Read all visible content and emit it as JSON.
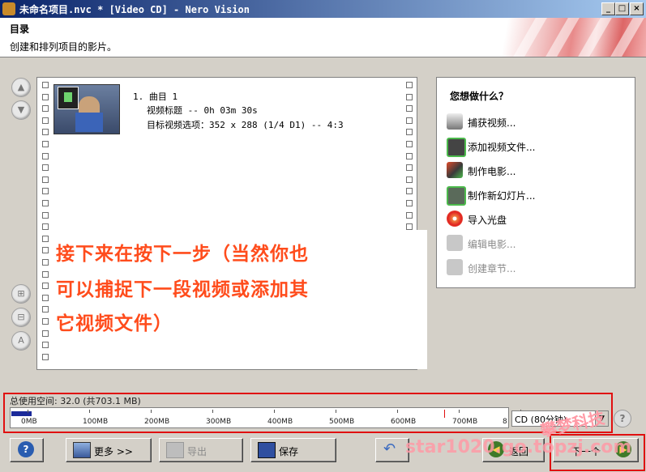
{
  "window": {
    "title": "未命名项目.nvc * [Video CD] - Nero Vision",
    "minimize": "_",
    "maximize": "□",
    "close": "×"
  },
  "header": {
    "title": "目录",
    "subtitle": "创建和排列项目的影片。"
  },
  "clip": {
    "index_title": "1. 曲目 1",
    "video_title": "视频标题 -- 0h 03m 30s",
    "target_options": "目标视频选项：352 x 288 (1/4 D1) -- 4:3"
  },
  "annotation": {
    "line1": "接下来在按下一步（当然你也",
    "line2": "可以捕捉下一段视频或添加其",
    "line3": "它视频文件）"
  },
  "right_panel": {
    "title": "您想做什么？",
    "actions": [
      {
        "label": "捕获视频...",
        "icon": "capture-video-icon",
        "enabled": true
      },
      {
        "label": "添加视频文件...",
        "icon": "add-video-file-icon",
        "enabled": true
      },
      {
        "label": "制作电影...",
        "icon": "make-movie-icon",
        "enabled": true
      },
      {
        "label": "制作新幻灯片...",
        "icon": "slideshow-icon",
        "enabled": true
      },
      {
        "label": "导入光盘",
        "icon": "import-disc-icon",
        "enabled": true
      },
      {
        "label": "编辑电影...",
        "icon": "edit-movie-icon",
        "enabled": false
      },
      {
        "label": "创建章节...",
        "icon": "create-chapter-icon",
        "enabled": false
      }
    ]
  },
  "space": {
    "label": "总使用空间: 32.0 (共703.1 MB)",
    "used_mb": 32.0,
    "total_mb": 703.1,
    "ticks": [
      "0MB",
      "100MB",
      "200MB",
      "300MB",
      "400MB",
      "500MB",
      "600MB",
      "700MB",
      "8"
    ],
    "disc_type": "CD (80分钟)"
  },
  "buttons": {
    "help": "?",
    "more": "更多 >>",
    "export": "导出",
    "save": "保存",
    "back": "返回",
    "next": "下一个"
  },
  "watermark": {
    "line1": "攀梦科技",
    "line2": "star1020.go.topzj.com"
  },
  "colors": {
    "annotation": "#ff4c1c",
    "highlight_frame": "#e01010",
    "title_bar": "#0a246a",
    "used_space": "#1b2a9a"
  }
}
